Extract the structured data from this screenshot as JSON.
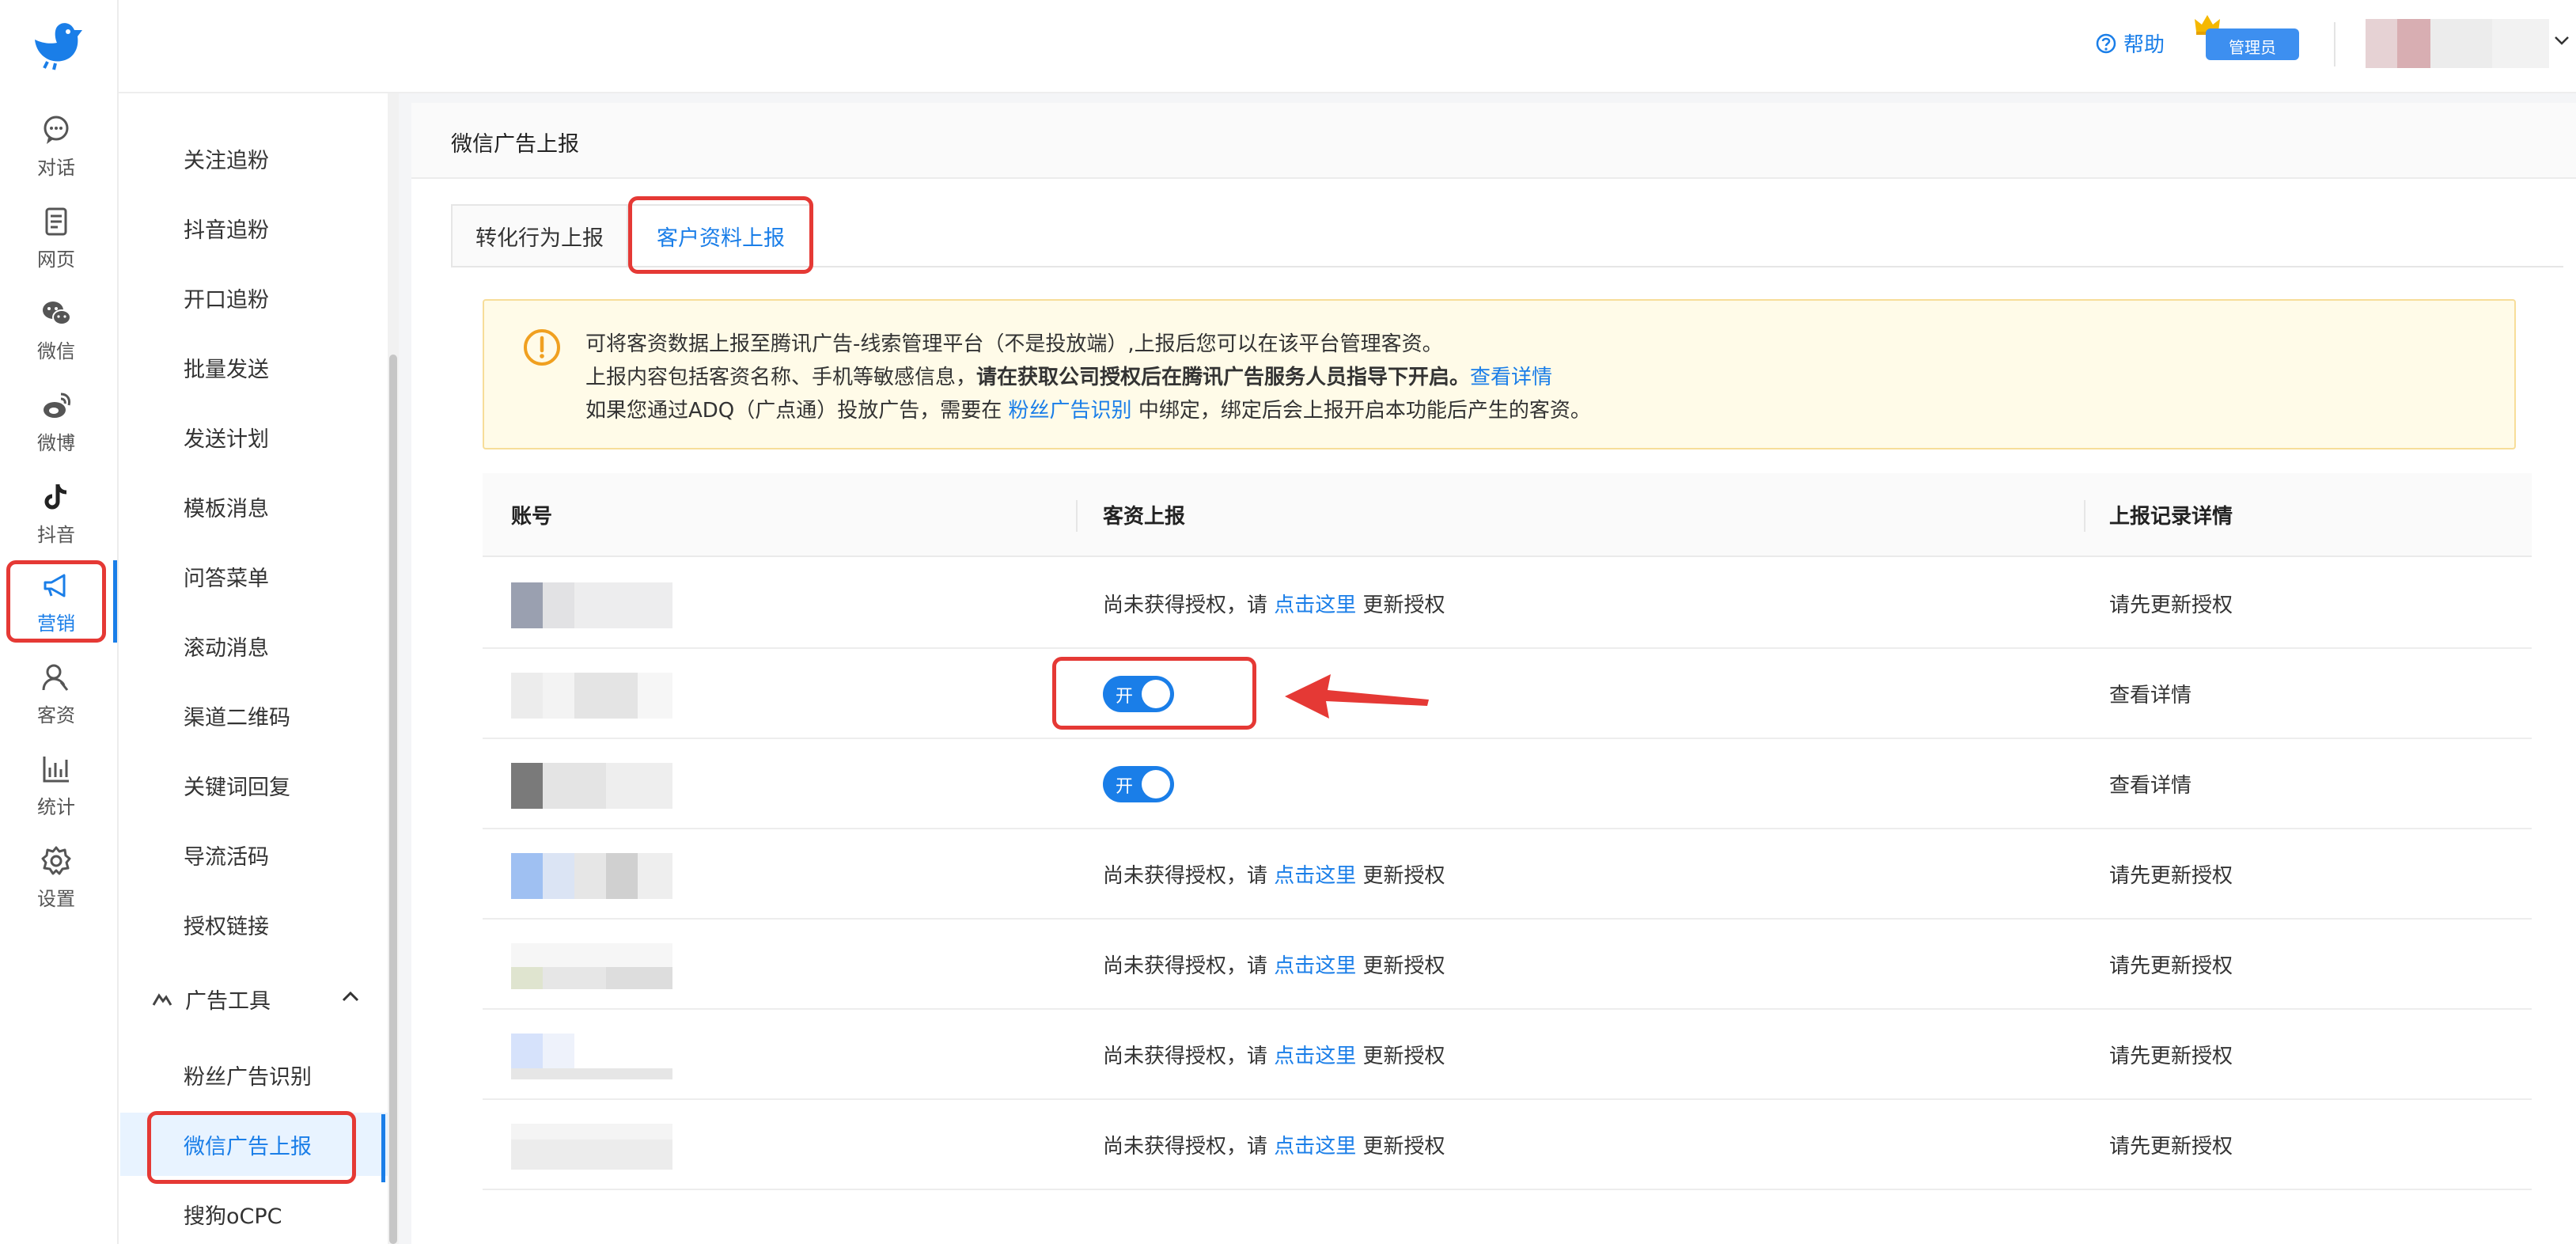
{
  "rail": {
    "items": [
      {
        "label": "对话",
        "icon": "chat-icon"
      },
      {
        "label": "网页",
        "icon": "webpage-icon"
      },
      {
        "label": "微信",
        "icon": "wechat-icon"
      },
      {
        "label": "微博",
        "icon": "weibo-icon"
      },
      {
        "label": "抖音",
        "icon": "douyin-icon"
      },
      {
        "label": "营销",
        "icon": "megaphone-icon"
      },
      {
        "label": "客资",
        "icon": "customer-icon"
      },
      {
        "label": "统计",
        "icon": "stats-icon"
      },
      {
        "label": "设置",
        "icon": "gear-icon"
      }
    ],
    "active": "营销"
  },
  "menu": {
    "items": [
      "关注追粉",
      "抖音追粉",
      "开口追粉",
      "批量发送",
      "发送计划",
      "模板消息",
      "问答菜单",
      "滚动消息",
      "渠道二维码",
      "关键词回复",
      "导流活码",
      "授权链接"
    ],
    "group": "广告工具",
    "sub_items": [
      "粉丝广告识别",
      "微信广告上报",
      "搜狗oCPC"
    ],
    "active": "微信广告上报"
  },
  "header": {
    "help": "帮助",
    "admin_badge": "管理员"
  },
  "page": {
    "title": "微信广告上报",
    "tabs": [
      "转化行为上报",
      "客户资料上报"
    ],
    "active_tab": "客户资料上报"
  },
  "notice": {
    "line1": "可将客资数据上报至腾讯广告-线索管理平台（不是投放端）,上报后您可以在该平台管理客资。",
    "line2_a": "上报内容包括客资名称、手机等敏感信息，",
    "line2_bold": "请在获取公司授权后在腾讯广告服务人员指导下开启。",
    "line2_link": "查看详情",
    "line3_a": "如果您通过ADQ（广点通）投放广告，需要在 ",
    "line3_link": "粉丝广告识别",
    "line3_b": " 中绑定，绑定后会上报开启本功能后产生的客资。"
  },
  "table": {
    "headers": [
      "账号",
      "客资上报",
      "上报记录详情"
    ],
    "unauth_prefix": "尚未获得授权，请 ",
    "unauth_link": "点击这里",
    "unauth_suffix": " 更新授权",
    "toggle_on": "开",
    "detail_link": "查看详情",
    "update_first": "请先更新授权",
    "rows": [
      "unauth",
      "on",
      "on",
      "unauth",
      "unauth",
      "unauth",
      "unauth"
    ]
  },
  "colors": {
    "accent": "#1a7ee8",
    "highlight": "#e53935",
    "notice_bg": "#fffbe8"
  }
}
